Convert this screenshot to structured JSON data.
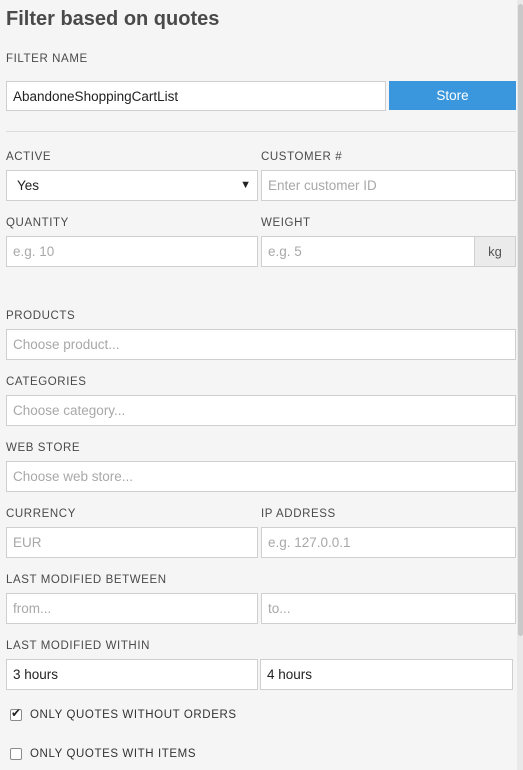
{
  "page": {
    "title": "Filter based on quotes"
  },
  "filter_name": {
    "label": "FILTER NAME",
    "value": "AbandoneShoppingCartList",
    "store_label": "Store"
  },
  "active": {
    "label": "ACTIVE",
    "value": "Yes"
  },
  "customer": {
    "label": "CUSTOMER #",
    "placeholder": "Enter customer ID"
  },
  "quantity": {
    "label": "QUANTITY",
    "placeholder": "e.g. 10"
  },
  "weight": {
    "label": "WEIGHT",
    "placeholder": "e.g. 5",
    "unit": "kg"
  },
  "products": {
    "label": "PRODUCTS",
    "placeholder": "Choose product..."
  },
  "categories": {
    "label": "CATEGORIES",
    "placeholder": "Choose category..."
  },
  "web_store": {
    "label": "WEB STORE",
    "placeholder": "Choose web store..."
  },
  "currency": {
    "label": "CURRENCY",
    "placeholder": "EUR"
  },
  "ip_address": {
    "label": "IP ADDRESS",
    "placeholder": "e.g. 127.0.0.1"
  },
  "last_modified_between": {
    "label": "LAST MODIFIED BETWEEN",
    "from_placeholder": "from...",
    "to_placeholder": "to..."
  },
  "last_modified_within": {
    "label": "LAST MODIFIED WITHIN",
    "from_value": "3 hours",
    "to_value": "4 hours"
  },
  "options": [
    {
      "label": "ONLY QUOTES WITHOUT ORDERS",
      "checked": true,
      "mark": "✔"
    },
    {
      "label": "ONLY QUOTES WITH ITEMS",
      "checked": false,
      "mark": ""
    }
  ],
  "icons": {
    "dropdown": "▼"
  }
}
